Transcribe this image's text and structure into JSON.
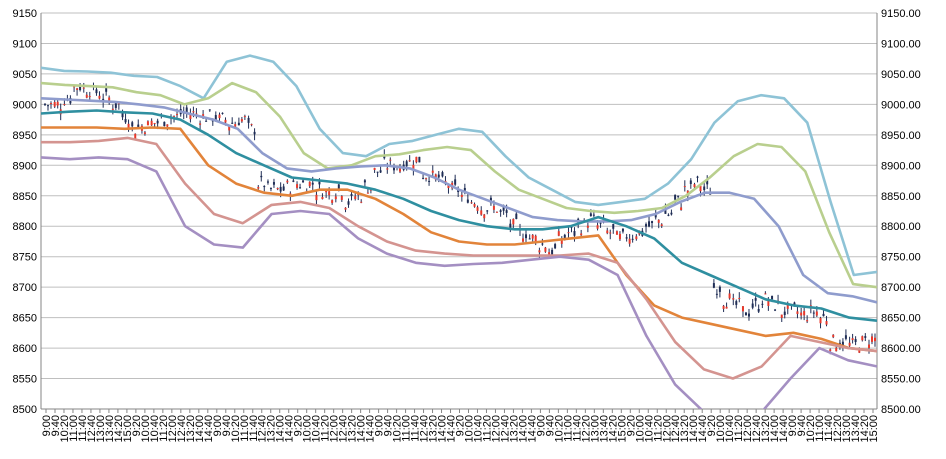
{
  "chart_data": {
    "type": "line",
    "title": "",
    "xlabel": "",
    "ylabel": "",
    "ylim": [
      8500,
      9150
    ],
    "y_ticks": [
      8500,
      8550,
      8600,
      8650,
      8700,
      8750,
      8800,
      8850,
      8900,
      8950,
      9000,
      9050,
      9100,
      9150
    ],
    "y_left_labels": [
      "8500",
      "8550",
      "8600",
      "8650",
      "8700",
      "8750",
      "8800",
      "8850",
      "8900",
      "8950",
      "9000",
      "9050",
      "9100",
      "9150"
    ],
    "y_right_labels": [
      "8500.00",
      "8550.00",
      "8600.00",
      "8650.00",
      "8700.00",
      "8750.00",
      "8800.00",
      "8850.00",
      "8900.00",
      "8950.00",
      "9000.00",
      "9050.00",
      "9100.00",
      "9150.00"
    ],
    "x_labels": [
      "9:00",
      "9:40",
      "10:20",
      "11:00",
      "11:40",
      "12:40",
      "13:00",
      "13:40",
      "14:20",
      "15:00",
      "9:20",
      "10:00",
      "10:40",
      "11:20",
      "12:00",
      "12:40",
      "13:20",
      "14:00",
      "14:40",
      "9:00",
      "9:40",
      "10:20",
      "11:00",
      "11:40",
      "12:40",
      "13:20",
      "14:00",
      "14:40",
      "9:20",
      "10:00",
      "10:40",
      "11:20",
      "12:00",
      "12:40",
      "13:20",
      "14:00",
      "14:40",
      "9:00",
      "9:40",
      "10:20",
      "11:00",
      "11:40",
      "12:40",
      "13:20",
      "14:00",
      "14:40",
      "9:20",
      "10:00",
      "10:40",
      "11:20",
      "12:00",
      "12:40",
      "13:20",
      "14:00",
      "14:40",
      "9:00",
      "9:40",
      "10:20",
      "11:00",
      "11:40",
      "12:20",
      "13:00",
      "13:40",
      "14:20",
      "15:00",
      "9:20",
      "10:00",
      "10:40",
      "11:20",
      "12:00",
      "12:40",
      "13:20",
      "14:00",
      "14:40",
      "9:20",
      "10:00",
      "10:40",
      "11:20",
      "12:00",
      "12:40",
      "13:20",
      "14:00",
      "14:40",
      "9:00",
      "9:40",
      "10:20",
      "11:00",
      "11:40",
      "12:20",
      "13:00",
      "13:40",
      "14:20",
      "15:00"
    ],
    "grid": true,
    "colors": {
      "plus3": "#8ec3d6",
      "plus2": "#b9cf8e",
      "plus1": "#8f9ccd",
      "center": "#2f8fa0",
      "short_ma": "#e2843a",
      "minus1": "#d49490",
      "minus2": "#a48fc2",
      "candle_up": "#e8382a",
      "candle_down": "#1f2d55"
    },
    "series": [
      {
        "key": "plus3",
        "t": [
          0,
          2,
          4,
          6,
          8,
          10,
          12,
          14,
          16,
          18,
          20,
          22,
          24,
          26,
          28,
          30,
          32,
          34,
          36,
          38,
          40,
          42,
          44,
          46,
          48,
          50,
          52,
          54,
          56,
          58,
          60,
          62,
          64,
          66,
          68,
          70,
          72,
          74,
          76,
          78,
          80,
          82,
          84,
          86,
          88,
          90,
          92
        ],
        "values": [
          9060,
          9055,
          9054,
          9052,
          9047,
          9045,
          9030,
          9010,
          9070,
          9080,
          9070,
          9030,
          8960,
          8920,
          8915,
          8935,
          8940,
          8950,
          8960,
          8955,
          8915,
          8880,
          8860,
          8840,
          8835,
          8840,
          8845,
          8870,
          8910,
          8970,
          9005,
          9015,
          9010,
          8970,
          8840,
          8720,
          8725
        ]
      },
      {
        "key": "plus2",
        "t": [
          0,
          2,
          4,
          6,
          8,
          10,
          12,
          14,
          16,
          18,
          20,
          22,
          24,
          26,
          28,
          30,
          32,
          34,
          36,
          38,
          40,
          42,
          44,
          46,
          48,
          50,
          52,
          54,
          56,
          58,
          60,
          62,
          64,
          66,
          68,
          70,
          72,
          74,
          76,
          78,
          80,
          82,
          84,
          86,
          88,
          90,
          92
        ],
        "values": [
          9035,
          9032,
          9030,
          9028,
          9020,
          9015,
          9000,
          9010,
          9035,
          9020,
          8980,
          8920,
          8895,
          8900,
          8915,
          8918,
          8925,
          8930,
          8925,
          8890,
          8860,
          8845,
          8830,
          8825,
          8822,
          8825,
          8830,
          8850,
          8880,
          8915,
          8935,
          8930,
          8890,
          8790,
          8705,
          8700
        ]
      },
      {
        "key": "plus1",
        "t": [
          0,
          2,
          4,
          6,
          8,
          10,
          12,
          14,
          16,
          18,
          20,
          22,
          24,
          26,
          28,
          30,
          32,
          34,
          36,
          38,
          40,
          42,
          44,
          46,
          48,
          50,
          52,
          54,
          56,
          58,
          60,
          62,
          64,
          66,
          68,
          70,
          72,
          74,
          76,
          78,
          80,
          82,
          84,
          86,
          88,
          90,
          92
        ],
        "values": [
          9010,
          9008,
          9006,
          9004,
          9000,
          8995,
          8985,
          8975,
          8960,
          8920,
          8895,
          8890,
          8895,
          8898,
          8900,
          8895,
          8880,
          8860,
          8845,
          8830,
          8815,
          8810,
          8808,
          8808,
          8810,
          8820,
          8840,
          8855,
          8855,
          8845,
          8800,
          8720,
          8690,
          8685,
          8675
        ]
      },
      {
        "key": "center",
        "t": [
          0,
          2,
          4,
          6,
          8,
          10,
          12,
          14,
          16,
          18,
          20,
          22,
          24,
          26,
          28,
          30,
          32,
          34,
          36,
          38,
          40,
          42,
          44,
          46,
          48,
          50,
          52,
          54,
          56,
          58,
          60,
          62,
          64,
          66,
          68,
          70,
          72,
          74,
          76,
          78,
          80,
          82,
          84,
          86,
          88,
          90,
          92
        ],
        "values": [
          8985,
          8988,
          8990,
          8987,
          8985,
          8975,
          8950,
          8920,
          8900,
          8880,
          8875,
          8870,
          8860,
          8845,
          8825,
          8810,
          8800,
          8795,
          8795,
          8800,
          8815,
          8800,
          8780,
          8740,
          8720,
          8700,
          8680,
          8670,
          8665,
          8650,
          8645
        ]
      },
      {
        "key": "short_ma",
        "t": [
          0,
          2,
          4,
          6,
          8,
          10,
          12,
          14,
          16,
          18,
          20,
          22,
          24,
          26,
          28,
          30,
          32,
          34,
          36,
          38,
          40,
          42,
          44,
          46,
          48,
          50,
          52,
          54,
          56,
          58,
          60,
          62,
          64,
          66,
          68,
          70,
          72,
          74,
          76,
          78,
          80,
          82,
          84,
          86,
          88,
          90,
          92
        ],
        "values": [
          8962,
          8962,
          8962,
          8960,
          8962,
          8960,
          8900,
          8870,
          8855,
          8850,
          8860,
          8860,
          8845,
          8820,
          8790,
          8775,
          8770,
          8770,
          8775,
          8780,
          8785,
          8720,
          8670,
          8650,
          8640,
          8630,
          8620,
          8625,
          8615,
          8600,
          8595
        ]
      },
      {
        "key": "minus1",
        "t": [
          0,
          2,
          4,
          6,
          8,
          10,
          12,
          14,
          16,
          18,
          20,
          22,
          24,
          26,
          28,
          30,
          32,
          34,
          36,
          38,
          40,
          42,
          44,
          46,
          48,
          50,
          52,
          54,
          56,
          58,
          60,
          62,
          64,
          66,
          68,
          70,
          72,
          74,
          76,
          78,
          80,
          82,
          84,
          86,
          88,
          90,
          92
        ],
        "values": [
          8938,
          8938,
          8940,
          8945,
          8935,
          8870,
          8820,
          8805,
          8835,
          8840,
          8830,
          8800,
          8775,
          8760,
          8755,
          8752,
          8752,
          8752,
          8752,
          8755,
          8740,
          8680,
          8610,
          8565,
          8550,
          8570,
          8620,
          8610,
          8600,
          8595
        ]
      },
      {
        "key": "minus2",
        "t": [
          0,
          2,
          4,
          6,
          8,
          10,
          12,
          14,
          16,
          18,
          20,
          22,
          24,
          26,
          28,
          30,
          32,
          34,
          36,
          38,
          40,
          42,
          44,
          46,
          48,
          50,
          52,
          54,
          56,
          58,
          60,
          62,
          64,
          66,
          68,
          70,
          72,
          74,
          76,
          78,
          80,
          82,
          84,
          86,
          88,
          90,
          92
        ],
        "values": [
          8913,
          8910,
          8913,
          8910,
          8890,
          8800,
          8770,
          8765,
          8820,
          8825,
          8820,
          8780,
          8755,
          8740,
          8735,
          8738,
          8740,
          8745,
          8750,
          8745,
          8720,
          8620,
          8540,
          8490,
          8480,
          8480,
          8550,
          8600,
          8580,
          8570
        ]
      }
    ],
    "candles_path": [
      9000,
      9000,
      9010,
      9030,
      9025,
      9020,
      9010,
      9000,
      8980,
      8960,
      8965,
      8970,
      8975,
      8980,
      8985,
      8985,
      8980,
      8980,
      8975,
      8970,
      8975,
      8960,
      8870,
      8860,
      8860,
      8865,
      8870,
      8870,
      8860,
      8855,
      8860,
      8840,
      8850,
      8865,
      8890,
      8900,
      8900,
      8905,
      8910,
      8885,
      8880,
      8870,
      8860,
      8850,
      8840,
      8830,
      8830,
      8820,
      8800,
      8790,
      8780,
      8770,
      8760,
      8780,
      8790,
      8800,
      8810,
      8800,
      8790,
      8780,
      8785,
      8790,
      8800,
      8810,
      8820,
      8840,
      8860,
      8870,
      8860,
      8700,
      8680,
      8670,
      8660,
      8670,
      8680,
      8670,
      8660,
      8660,
      8655,
      8660,
      8650,
      8610,
      8610,
      8605,
      8610,
      8615
    ]
  }
}
